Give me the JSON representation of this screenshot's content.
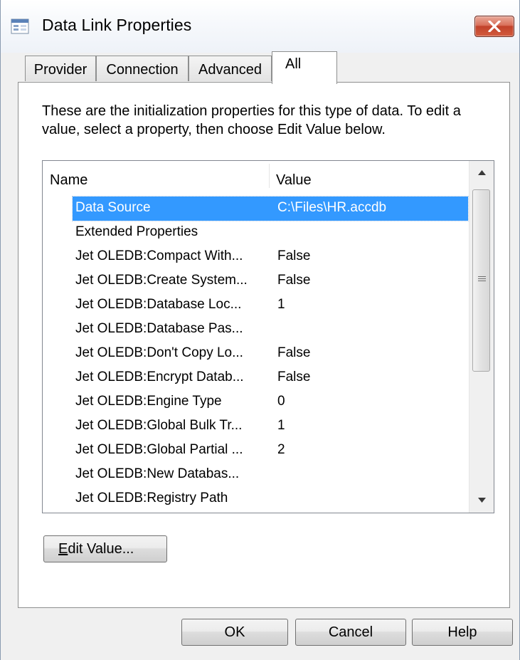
{
  "window": {
    "title": "Data Link Properties",
    "icon": "data-link-icon",
    "close_icon": "close-icon"
  },
  "tabs": [
    {
      "label": "Provider",
      "active": false
    },
    {
      "label": "Connection",
      "active": false
    },
    {
      "label": "Advanced",
      "active": false
    },
    {
      "label": "All",
      "active": true
    }
  ],
  "description": "These are the initialization properties for this type of data. To edit a value, select a property, then choose Edit Value below.",
  "list": {
    "columns": [
      "Name",
      "Value"
    ],
    "rows": [
      {
        "name": "Data Source",
        "value": "C:\\Files\\HR.accdb",
        "selected": true
      },
      {
        "name": "Extended Properties",
        "value": ""
      },
      {
        "name": "Jet OLEDB:Compact With...",
        "value": "False"
      },
      {
        "name": "Jet OLEDB:Create System...",
        "value": "False"
      },
      {
        "name": "Jet OLEDB:Database Loc...",
        "value": "1"
      },
      {
        "name": "Jet OLEDB:Database Pas...",
        "value": ""
      },
      {
        "name": "Jet OLEDB:Don't Copy Lo...",
        "value": "False"
      },
      {
        "name": "Jet OLEDB:Encrypt Datab...",
        "value": "False"
      },
      {
        "name": "Jet OLEDB:Engine Type",
        "value": "0"
      },
      {
        "name": "Jet OLEDB:Global Bulk Tr...",
        "value": "1"
      },
      {
        "name": "Jet OLEDB:Global Partial ...",
        "value": "2"
      },
      {
        "name": "Jet OLEDB:New Databas...",
        "value": ""
      },
      {
        "name": "Jet OLEDB:Registry Path",
        "value": ""
      }
    ],
    "selection_color": "#3399ff"
  },
  "buttons": {
    "edit_value_accel": "E",
    "edit_value_rest": "dit Value...",
    "ok": "OK",
    "cancel": "Cancel",
    "help": "Help"
  }
}
